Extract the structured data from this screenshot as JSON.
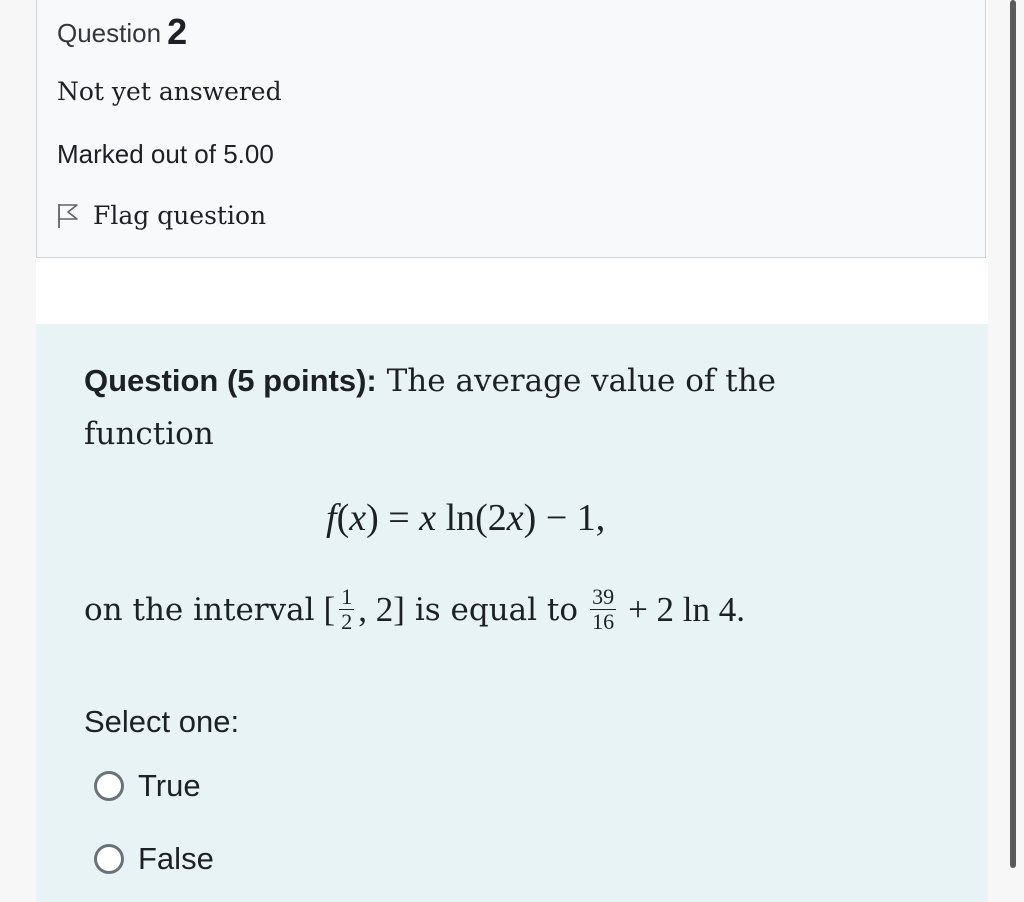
{
  "question_info": {
    "question_word": "Question",
    "question_number": "2",
    "state": "Not yet answered",
    "grade": "Marked out of 5.00",
    "flag_label": "Flag question"
  },
  "formulation": {
    "bold_prefix": "Question (5 points):",
    "text_intro": " The average value of the function",
    "formula": {
      "f": "f",
      "x1": "x",
      "eq": "=",
      "x2": "x",
      "ln": "ln",
      "arg_open": "(2",
      "x3": "x",
      "arg_close": ")",
      "minus_tail": "− 1,"
    },
    "interval": {
      "prefix": "on the interval",
      "open_bracket": "[",
      "frac_num": "1",
      "frac_den": "2",
      "middle": ", 2]",
      "is_equal_to": "is equal to",
      "answer_num": "39",
      "answer_den": "16",
      "answer_tail": "+ 2 ln 4."
    },
    "select_one": "Select one:",
    "options": [
      {
        "label": "True"
      },
      {
        "label": "False"
      }
    ]
  },
  "icons": {
    "flag": "flag-outline-icon",
    "radio": "radio-unchecked-icon"
  },
  "colors": {
    "info_background": "#f8f9fa",
    "formulation_background": "#e7f3f5",
    "text": "#1d2125"
  }
}
